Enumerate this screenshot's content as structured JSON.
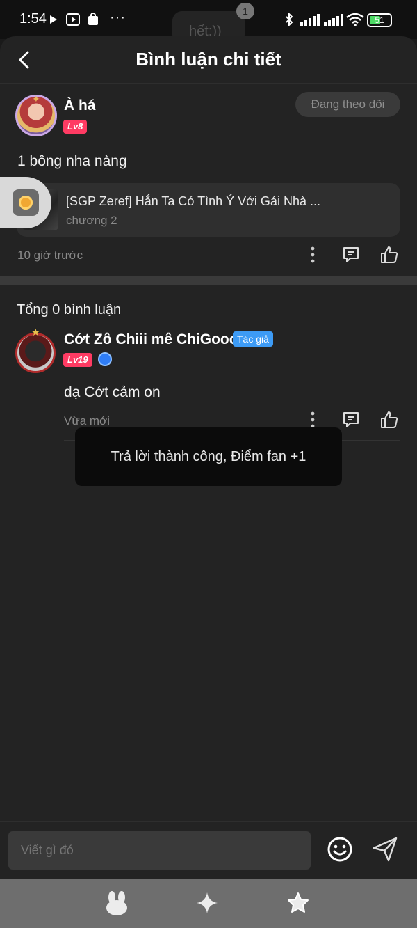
{
  "status_bar": {
    "time": "1:54",
    "dots": "···",
    "battery": "51",
    "ghost_text": "hết:))",
    "ghost_badge": "1"
  },
  "header": {
    "title": "Bình luận chi tiết"
  },
  "comment": {
    "username": "À há",
    "level": "Lv8",
    "follow_label": "Đang theo dõi",
    "text": "1 bông nha nàng",
    "chapter_title": "[SGP Zeref] Hắn Ta Có Tình Ý Với Gái Nhà ...",
    "chapter_sub": "chương 2",
    "time": "10 giờ trước"
  },
  "replies": {
    "section_title": "Tổng 0 bình luận",
    "items": [
      {
        "username": "Cớt Zô Chiii mê ChiGooo",
        "author_tag": "Tác giả",
        "level": "Lv19",
        "text": "dạ Cớt cảm on",
        "time": "Vừa mới"
      }
    ]
  },
  "toast": {
    "message": "Trả lời thành công, Điểm fan +1"
  },
  "composer": {
    "placeholder": "Viết gì đó"
  },
  "colors": {
    "background": "#232323",
    "level_badge": "#ff3b63",
    "author_tag": "#3d9bf5",
    "toast_bg": "#0b0b0b"
  },
  "icons": [
    "back-icon",
    "more-icon",
    "reply-icon",
    "like-icon",
    "emoji-icon",
    "send-icon",
    "bunny-icon",
    "sparkle-icon",
    "star-icon"
  ]
}
